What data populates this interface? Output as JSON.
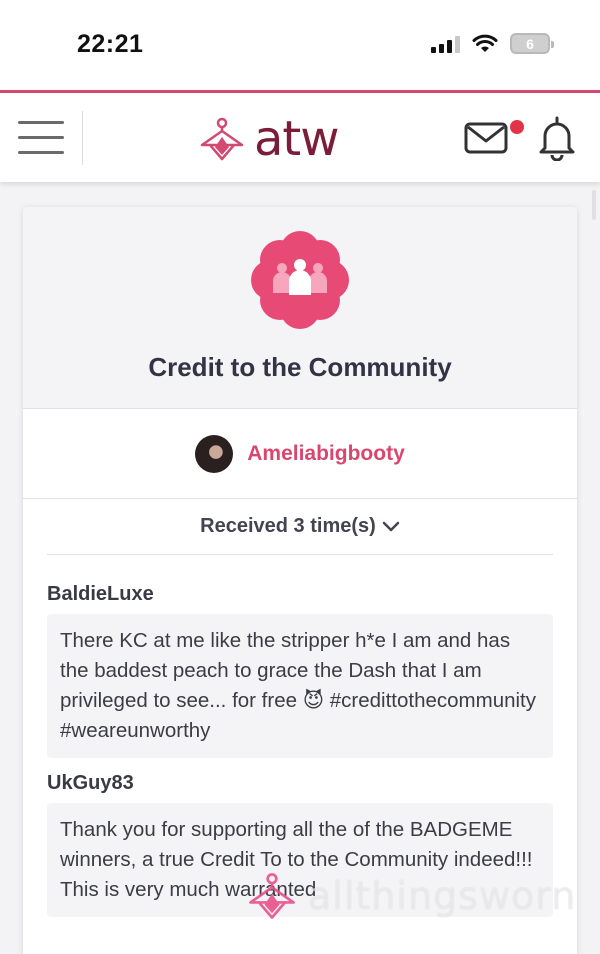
{
  "status_bar": {
    "time": "22:21",
    "battery": "6"
  },
  "header": {
    "logo_text": "atw",
    "accent_color": "#d24a72"
  },
  "card": {
    "title": "Credit to the Community",
    "badge_icon": "community-badge-icon",
    "user": {
      "name": "Ameliabigbooty"
    },
    "received_label": "Received 3 time(s)",
    "comments": [
      {
        "author": "BaldieLuxe",
        "text": "There KC at me like the stripper h*e I am and has the baddest peach to grace the Dash that I am privileged to see... for free 😈 #credittothecommunity #weareunworthy"
      },
      {
        "author": "UkGuy83",
        "text": "Thank you for supporting all the of the BADGEME winners, a true Credit To to the Community indeed!!! This is very much warranted"
      }
    ]
  },
  "watermark": {
    "text": "allthingsworn"
  }
}
